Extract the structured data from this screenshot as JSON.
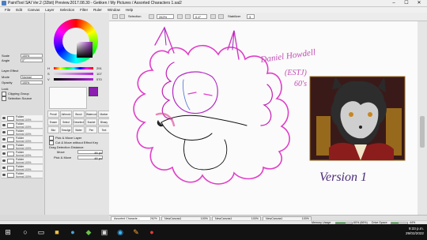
{
  "window": {
    "title": "PaintTool SAI Ver.2 (32bit) Preview.2017.08.30 - Gekken / My Pictures / Assorted Characters 1.sai2",
    "controls": [
      "–",
      "☐",
      "✕"
    ]
  },
  "menu": [
    "File",
    "Edit",
    "Canvas",
    "Layer",
    "Selection",
    "Filter",
    "Ruler",
    "Window",
    "Help"
  ],
  "toolbar": {
    "selection_label": "Selection",
    "zoom": "262%",
    "rotation": "0.4°",
    "stabilizer_label": "Stabilizer",
    "stabilizer_value": "3"
  },
  "left_panel": {
    "scale_label": "Scale",
    "scale_value": "100%",
    "angle_label": "Angle",
    "angle_value": "0°",
    "layer_effect_label": "Layer Effect",
    "mode_label": "Mode",
    "mode_value": "Normal",
    "opacity_label": "Opacity",
    "opacity_value": "100%",
    "lock_label": "Lock",
    "clipping_group": "Clipping Group",
    "selection_source": "Selection Source"
  },
  "color": {
    "h": {
      "label": "H",
      "value": "291"
    },
    "s": {
      "label": "S",
      "value": "107"
    },
    "v": {
      "label": "V",
      "value": "070"
    },
    "current": "#8a1fb0"
  },
  "layers": [
    {
      "name": "Folder",
      "mode": "Normal 100%"
    },
    {
      "name": "Folder",
      "mode": "Normal 100%"
    },
    {
      "name": "Folder",
      "mode": "Normal 100%"
    },
    {
      "name": "Folder",
      "mode": "Normal 100%"
    },
    {
      "name": "Folder",
      "mode": "Normal 100%"
    },
    {
      "name": "Folder",
      "mode": "Normal 100%"
    },
    {
      "name": "Folder",
      "mode": "Normal 100%"
    },
    {
      "name": "Folder",
      "mode": "Normal 100%"
    },
    {
      "name": "Folder",
      "mode": "Normal 100%"
    }
  ],
  "tools": [
    "Pencil",
    "Airbrush",
    "Brush",
    "Watercolor",
    "Marker",
    "Eraser",
    "Select",
    "Deselect",
    "Bucket",
    "Binary",
    "Blur",
    "Smudge",
    "Water",
    "Pen",
    "Text"
  ],
  "tool_options": {
    "pick_more": "Pick & Move Layer",
    "cut_move": "Cut & Move without Effect Key",
    "drag_label": "Drag Detection Distance:",
    "move_label": "Move",
    "move_value": "48 px",
    "pick_move_label": "Pick & Move",
    "pick_move_value": "48 px"
  },
  "canvas": {
    "note_name": "Daniel Howdell",
    "note_type": "(ESTJ)",
    "note_era": "60's",
    "version_label": "Version 1"
  },
  "tabs": [
    {
      "name": "Assorted Characte...",
      "pct": "262%"
    },
    {
      "name": "NewCanvas1",
      "pct": "100%"
    },
    {
      "name": "NewCanvas1",
      "pct": "100%"
    },
    {
      "name": "NewCanvas1",
      "pct": "100%"
    }
  ],
  "status": {
    "memory_label": "Memory Usage",
    "memory_value": "60% (66%)",
    "memory_frac": 0.6,
    "drive_label": "Drive Space",
    "drive_value": "44%",
    "drive_frac": 0.44
  },
  "taskbar": {
    "time": "9:33 p.m.",
    "date": "29/02/2022"
  }
}
